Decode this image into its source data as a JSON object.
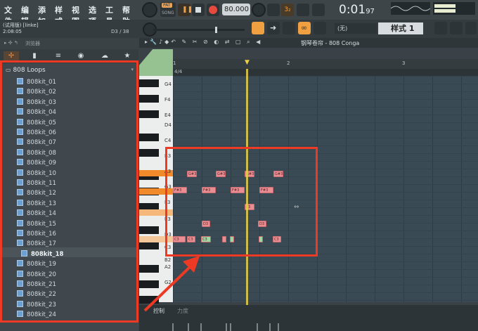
{
  "menu": {
    "items": [
      "文件",
      "编辑",
      "添加",
      "样式",
      "视图",
      "选项",
      "工具",
      "帮助"
    ]
  },
  "transport": {
    "pat_label": "PAT",
    "song_label": "SONG",
    "tempo": "80.000",
    "time": "0:01",
    "time_frac": "97",
    "beat_display": "3₂"
  },
  "project": {
    "title": "(试用版) [linke]",
    "time": "2:08:05",
    "position": "D3 / 38"
  },
  "options": {
    "snap": "(无)",
    "pattern": "样式 1"
  },
  "browser": {
    "header": "浏览器",
    "folder": "808 Loops",
    "items": [
      "808kit_01",
      "808kit_02",
      "808kit_03",
      "808kit_04",
      "808kit_05",
      "808kit_06",
      "808kit_07",
      "808kit_08",
      "808kit_09",
      "808kit_10",
      "808kit_11",
      "808kit_12",
      "808kit_13",
      "808kit_14",
      "808kit_15",
      "808kit_16",
      "808kit_17",
      "808kit_18",
      "808kit_19",
      "808kit_20",
      "808kit_21",
      "808kit_22",
      "808kit_23",
      "808kit_24"
    ],
    "selected_index": 17
  },
  "pianoroll": {
    "title": "钢琴卷帘 - 808 Conga",
    "bars": [
      "1",
      "2",
      "3"
    ],
    "time_sig": "4/4",
    "keys": [
      "G4",
      "F4",
      "E4",
      "D4",
      "C4",
      "B3",
      "A3",
      "G3",
      "F3",
      "E3",
      "D3",
      "C3",
      "B2",
      "A2",
      "G2"
    ],
    "notes": [
      {
        "label": "G#3",
        "color": "#e98f94"
      },
      {
        "label": "G#3",
        "color": "#e98f94"
      },
      {
        "label": "G#3",
        "color": "#e98f94"
      },
      {
        "label": "G#3",
        "color": "#e98f94"
      },
      {
        "label": "F#3",
        "color": "#e98f94"
      },
      {
        "label": "F#3",
        "color": "#e98f94"
      },
      {
        "label": "F#3",
        "color": "#e98f94"
      },
      {
        "label": "F#3",
        "color": "#e98f94"
      },
      {
        "label": "E3",
        "color": "#e98f94"
      },
      {
        "label": "D3",
        "color": "#e98f94"
      },
      {
        "label": "D3",
        "color": "#e98f94"
      },
      {
        "label": "C3",
        "color": "#e98f94"
      },
      {
        "label": "C3",
        "color": "#e98f94"
      },
      {
        "label": "C3",
        "color": "#9fd6a2"
      },
      {
        "label": "",
        "color": "#e98f94"
      },
      {
        "label": "",
        "color": "#9fd6a2"
      },
      {
        "label": "",
        "color": "#9fd6a2"
      },
      {
        "label": "C3",
        "color": "#e98f94"
      }
    ]
  },
  "control": {
    "label": "控制",
    "label2": "力度"
  },
  "colors": {
    "highlight": "#ee3a24",
    "accent": "#f08a2a",
    "playhead": "#e8d048"
  }
}
